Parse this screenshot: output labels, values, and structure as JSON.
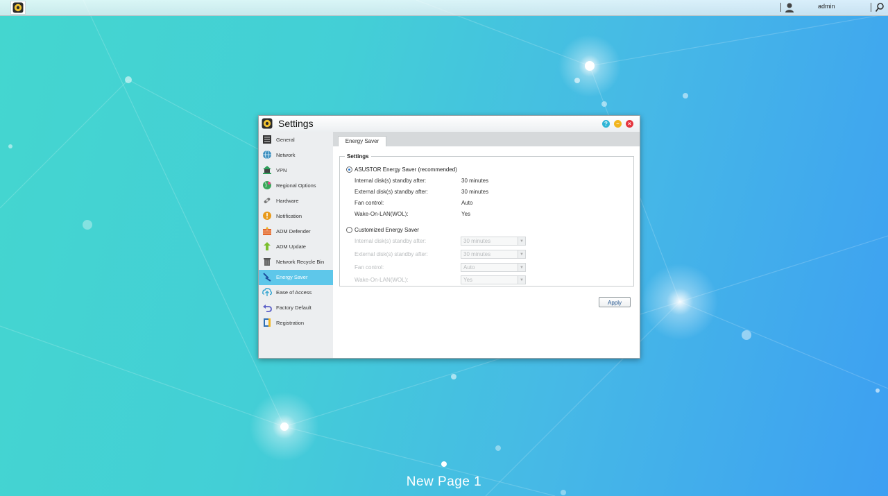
{
  "topbar": {
    "username": "admin"
  },
  "window": {
    "title": "Settings"
  },
  "sidebar": {
    "items": [
      {
        "label": "General",
        "icon": "general-icon"
      },
      {
        "label": "Network",
        "icon": "network-icon"
      },
      {
        "label": "VPN",
        "icon": "vpn-icon"
      },
      {
        "label": "Regional Options",
        "icon": "regional-options-icon"
      },
      {
        "label": "Hardware",
        "icon": "hardware-icon"
      },
      {
        "label": "Notification",
        "icon": "notification-icon"
      },
      {
        "label": "ADM Defender",
        "icon": "adm-defender-icon"
      },
      {
        "label": "ADM Update",
        "icon": "adm-update-icon"
      },
      {
        "label": "Network Recycle Bin",
        "icon": "recycle-bin-icon"
      },
      {
        "label": "Energy Saver",
        "icon": "energy-saver-icon"
      },
      {
        "label": "Ease of Access",
        "icon": "ease-of-access-icon"
      },
      {
        "label": "Factory Default",
        "icon": "factory-default-icon"
      },
      {
        "label": "Registration",
        "icon": "registration-icon"
      }
    ],
    "active_index": 9
  },
  "content": {
    "tab": "Energy Saver",
    "legend": "Settings",
    "option_recommended": {
      "label": "ASUSTOR Energy Saver (recommended)",
      "selected": true,
      "rows": [
        {
          "label": "Internal disk(s) standby after:",
          "value": "30 minutes"
        },
        {
          "label": "External disk(s) standby after:",
          "value": "30 minutes"
        },
        {
          "label": "Fan control:",
          "value": "Auto"
        },
        {
          "label": "Wake-On-LAN(WOL):",
          "value": "Yes"
        }
      ]
    },
    "option_custom": {
      "label": "Customized Energy Saver",
      "selected": false,
      "rows": [
        {
          "label": "Internal disk(s) standby after:",
          "value": "30 minutes"
        },
        {
          "label": "External disk(s) standby after:",
          "value": "30 minutes"
        },
        {
          "label": "Fan control:",
          "value": "Auto"
        },
        {
          "label": "Wake-On-LAN(WOL):",
          "value": "Yes"
        }
      ]
    },
    "apply_label": "Apply"
  },
  "desktop": {
    "page_label": "New Page 1"
  },
  "colors": {
    "active_nav": "#5ec7ea",
    "help_button": "#2fb5d6",
    "minimize_button": "#f2b51d",
    "close_button": "#e5363f"
  }
}
